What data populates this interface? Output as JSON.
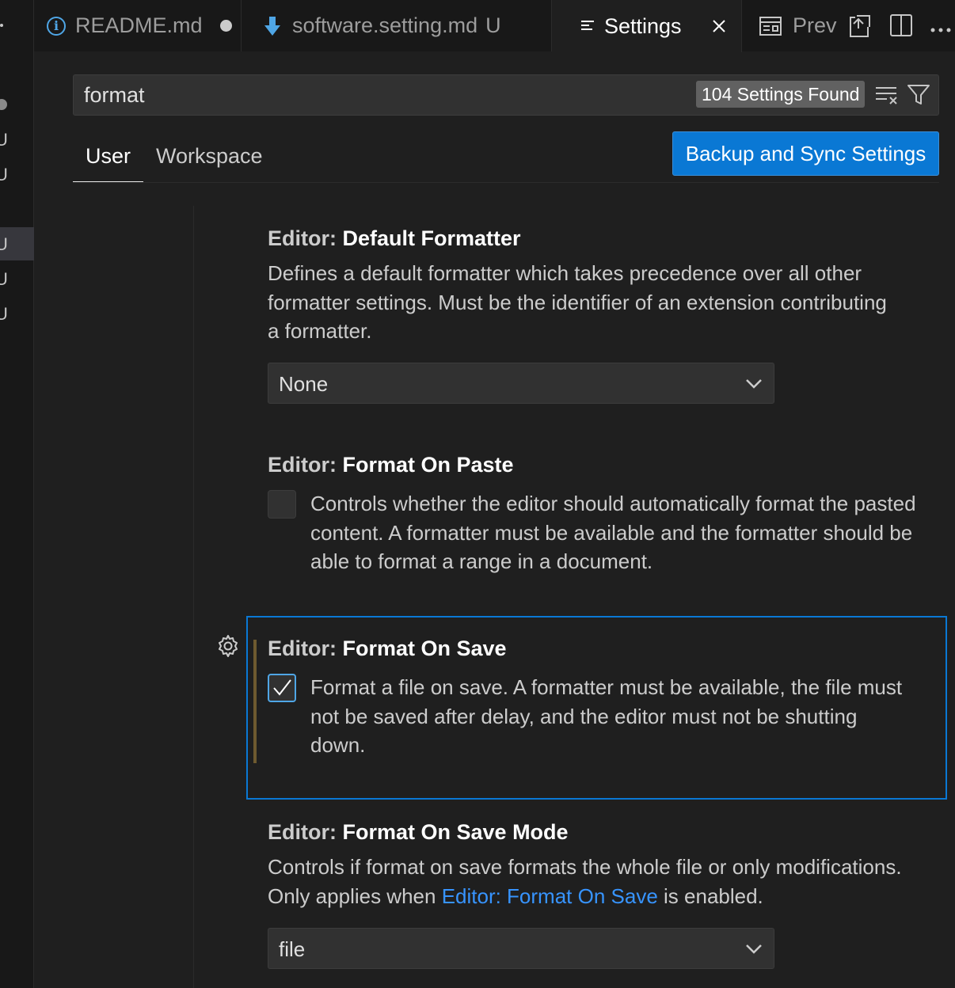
{
  "tabs": [
    {
      "label": "README.md",
      "icon": "info-icon",
      "state": "dirty"
    },
    {
      "label": "software.setting.md",
      "icon": "markdown-arrow-icon",
      "badge": "U"
    },
    {
      "label": "Settings",
      "icon": "settings-lines-icon",
      "active": true
    },
    {
      "label": "Prev",
      "icon": "preview-icon"
    }
  ],
  "side_marks": [
    "U",
    "U",
    "U",
    "U",
    "U"
  ],
  "search": {
    "value": "format",
    "count": "104 Settings Found"
  },
  "scope": {
    "user": "User",
    "workspace": "Workspace"
  },
  "sync_button": "Backup and Sync Settings",
  "settings": [
    {
      "category": "Editor: ",
      "name": "Default Formatter",
      "description": "Defines a default formatter which takes precedence over all other formatter settings. Must be the identifier of an extension contributing a formatter.",
      "control": "select",
      "value": "None"
    },
    {
      "category": "Editor: ",
      "name": "Format On Paste",
      "description": "Controls whether the editor should automatically format the pasted content. A formatter must be available and the formatter should be able to format a range in a document.",
      "control": "checkbox",
      "checked": false
    },
    {
      "category": "Editor: ",
      "name": "Format On Save",
      "description": "Format a file on save. A formatter must be available, the file must not be saved after delay, and the editor must not be shutting down.",
      "control": "checkbox",
      "checked": true,
      "focused": true,
      "modified": true
    },
    {
      "category": "Editor: ",
      "name": "Format On Save Mode",
      "description_before": "Controls if format on save formats the whole file or only modifications. Only applies when ",
      "description_link": "Editor: Format On Save",
      "description_after": " is enabled.",
      "control": "select",
      "value": "file"
    }
  ],
  "colors": {
    "accent": "#0a78d4",
    "link": "#3794ff",
    "background": "#1f1f1f"
  }
}
